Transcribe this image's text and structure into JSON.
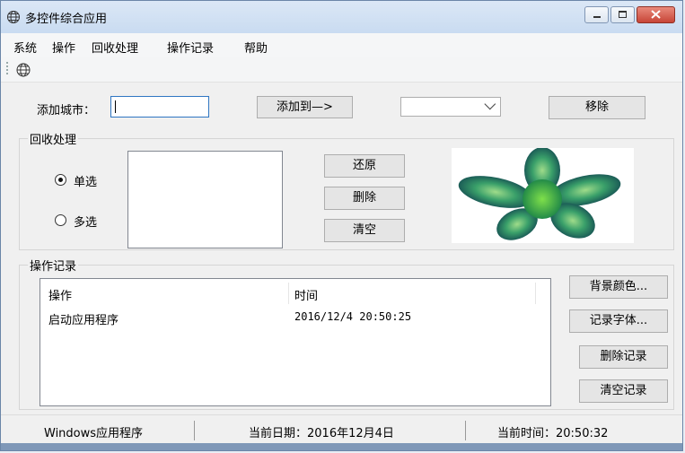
{
  "window": {
    "title": "多控件综合应用"
  },
  "menu": {
    "items": [
      "系统",
      "操作",
      "回收处理",
      "操作记录",
      "帮助"
    ]
  },
  "toolbar": {
    "icon": "globe-icon"
  },
  "city": {
    "label": "添加城市：",
    "input_value": "",
    "add_button": "添加到—>",
    "combo_value": "",
    "remove_button": "移除"
  },
  "recycle": {
    "group_title": "回收处理",
    "single_label": "单选",
    "multi_label": "多选",
    "restore_button": "还原",
    "delete_button": "删除",
    "clear_button": "清空"
  },
  "log": {
    "group_title": "操作记录",
    "columns": [
      "操作",
      "时间"
    ],
    "rows": [
      [
        "启动应用程序",
        "2016/12/4 20:50:25"
      ]
    ],
    "bg_color_button": "背景颜色...",
    "font_button": "记录字体...",
    "delete_button": "删除记录",
    "clear_button": "清空记录"
  },
  "status": {
    "app": "Windows应用程序",
    "date": "当前日期：2016年12月4日",
    "time": "当前时间：20:50:32"
  },
  "colors": {
    "title_bg": "#c9dbf1",
    "close_button": "#c74537",
    "accent": "#2f76c2"
  }
}
